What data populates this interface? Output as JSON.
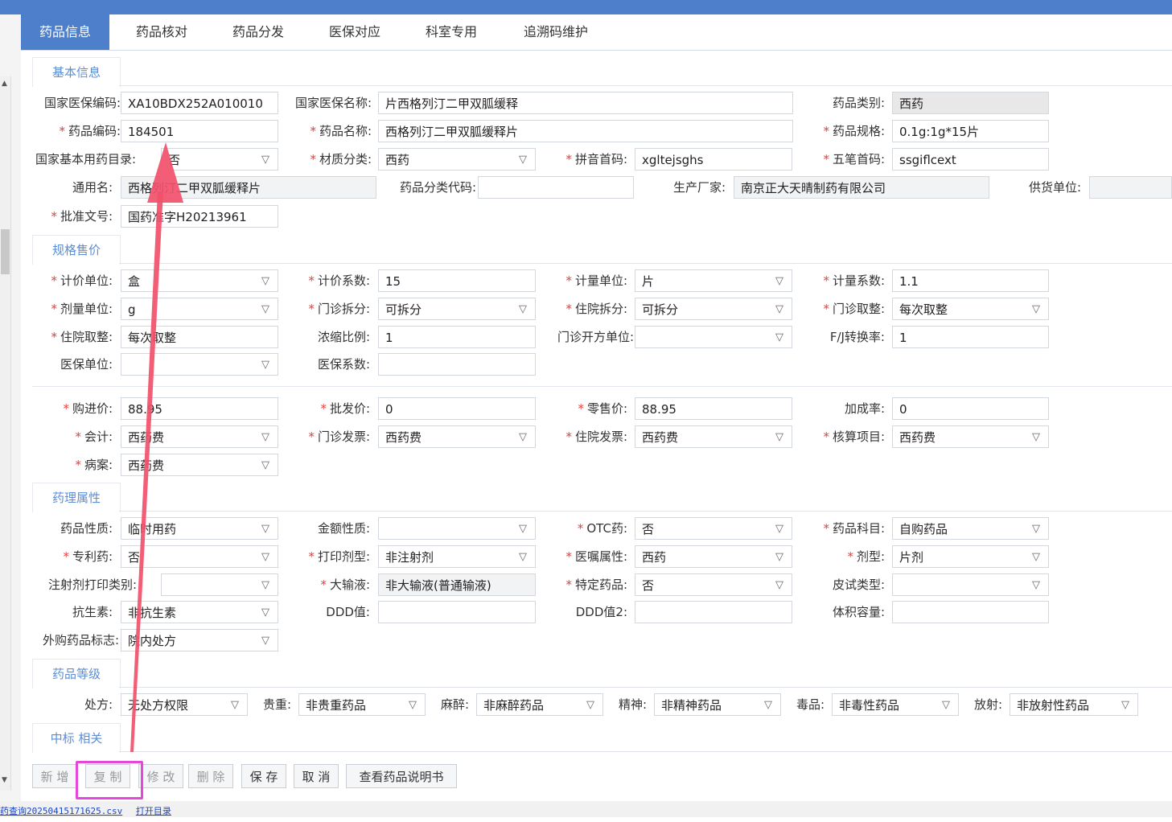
{
  "tabs": [
    "药品信息",
    "药品核对",
    "药品分发",
    "医保对应",
    "科室专用",
    "追溯码维护"
  ],
  "sections": {
    "basic": "基本信息",
    "spec": "规格售价",
    "pharm": "药理属性",
    "grade": "药品等级",
    "bid": "中标 相关"
  },
  "basic": {
    "nat_code_label": "国家医保编码:",
    "nat_code": "XA10BDX252A010010",
    "nat_name_label": "国家医保名称:",
    "nat_name": "片西格列汀二甲双胍缓释",
    "category_label": "药品类别:",
    "category": "西药",
    "code_label": "药品编码:",
    "code": "184501",
    "name_label": "药品名称:",
    "name": "西格列汀二甲双胍缓释片",
    "spec_label": "药品规格:",
    "spec": "0.1g:1g*15片",
    "essential_label": "国家基本用药目录:",
    "essential": "否",
    "material_label": "材质分类:",
    "material": "西药",
    "pinyin_label": "拼音首码:",
    "pinyin": "xgltejsghs",
    "wubi_label": "五笔首码:",
    "wubi": "ssgiflcext",
    "generic_label": "通用名:",
    "generic": "西格列汀二甲双胍缓释片",
    "classcode_label": "药品分类代码:",
    "classcode": "",
    "maker_label": "生产厂家:",
    "maker": "南京正大天晴制药有限公司",
    "supplier_label": "供货单位:",
    "supplier": "",
    "approval_label": "批准文号:",
    "approval": "国药准字H20213961"
  },
  "spec": {
    "price_unit_label": "计价单位:",
    "price_unit": "盒",
    "price_coef_label": "计价系数:",
    "price_coef": "15",
    "meas_unit_label": "计量单位:",
    "meas_unit": "片",
    "meas_coef_label": "计量系数:",
    "meas_coef": "1.1",
    "dose_unit_label": "剂量单位:",
    "dose_unit": "g",
    "op_split_label": "门诊拆分:",
    "op_split": "可拆分",
    "ip_split_label": "住院拆分:",
    "ip_split": "可拆分",
    "op_round_label": "门诊取整:",
    "op_round": "每次取整",
    "ip_round_label": "住院取整:",
    "ip_round": "每次取整",
    "ratio_label": "浓缩比例:",
    "ratio": "1",
    "op_rx_unit_label": "门诊开方单位:",
    "op_rx_unit": "",
    "fj_label": "F/J转换率:",
    "fj": "1",
    "ins_unit_label": "医保单位:",
    "ins_unit": "",
    "ins_coef_label": "医保系数:",
    "ins_coef": ""
  },
  "price": {
    "buy_label": "购进价:",
    "buy": "88.95",
    "whole_label": "批发价:",
    "whole": "0",
    "retail_label": "零售价:",
    "retail": "88.95",
    "markup_label": "加成率:",
    "markup": "0",
    "acct_label": "会计:",
    "acct": "西药费",
    "op_inv_label": "门诊发票:",
    "op_inv": "西药费",
    "ip_inv_label": "住院发票:",
    "ip_inv": "西药费",
    "calc_label": "核算项目:",
    "calc": "西药费",
    "case_label": "病案:",
    "case": "西药费"
  },
  "pharm": {
    "nature_label": "药品性质:",
    "nature": "临时用药",
    "amount_label": "金额性质:",
    "amount": "",
    "otc_label": "OTC药:",
    "otc": "否",
    "subject_label": "药品科目:",
    "subject": "自购药品",
    "patent_label": "专利药:",
    "patent": "否",
    "print_label": "打印剂型:",
    "print": "非注射剂",
    "order_label": "医嘱属性:",
    "order": "西药",
    "form_label": "剂型:",
    "form": "片剂",
    "inj_label": "注射剂打印类别:",
    "inj": "",
    "infusion_label": "大输液:",
    "infusion": "非大输液(普通输液)",
    "special_label": "特定药品:",
    "special": "否",
    "skin_label": "皮试类型:",
    "skin": "",
    "anti_label": "抗生素:",
    "anti": "非抗生素",
    "ddd_label": "DDD值:",
    "ddd": "",
    "ddd2_label": "DDD值2:",
    "ddd2": "",
    "vol_label": "体积容量:",
    "vol": "",
    "ext_label": "外购药品标志:",
    "ext": "院内处方"
  },
  "grade": {
    "rx_label": "处方:",
    "rx": "无处方权限",
    "prec_label": "贵重:",
    "prec": "非贵重药品",
    "anes_label": "麻醉:",
    "anes": "非麻醉药品",
    "psy_label": "精神:",
    "psy": "非精神药品",
    "tox_label": "毒品:",
    "tox": "非毒性药品",
    "rad_label": "放射:",
    "rad": "非放射性药品"
  },
  "buttons": {
    "add": "新 增",
    "copy": "复 制",
    "edit": "修 改",
    "del": "删 除",
    "save": "保 存",
    "cancel": "取 消",
    "manual": "查看药品说明书"
  },
  "status": {
    "file": "药查询20250415171625.csv",
    "open": "打开目录"
  },
  "colors": {
    "accent": "#4d7fcb",
    "required": "#e04040",
    "highlight": "#e646d9",
    "arrow": "#f2506b"
  }
}
